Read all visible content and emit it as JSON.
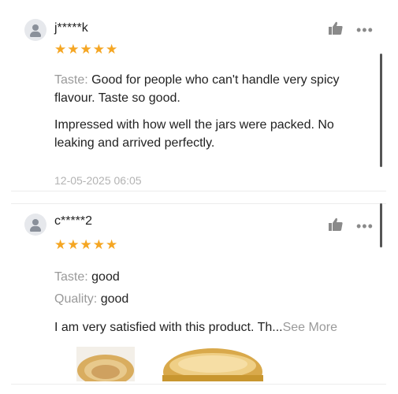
{
  "reviews": [
    {
      "username": "j*****k",
      "stars": "★★★★★",
      "taste_label": "Taste:",
      "taste_value": "Good for people who can't handle very spicy flavour.  Taste so good.",
      "comment": "Impressed with how well the jars were packed. No leaking and arrived perfectly.",
      "date": "12-05-2025 06:05"
    },
    {
      "username": "c*****2",
      "stars": "★★★★★",
      "taste_label": "Taste:",
      "taste_value": "good",
      "quality_label": "Quality:",
      "quality_value": "good",
      "comment": "I am very satisfied with this product.  Th...",
      "see_more": "See More"
    }
  ],
  "icons": {
    "like": "thumbs-up-icon",
    "more": "more-dots-icon",
    "avatar": "user-avatar-icon"
  },
  "colors": {
    "star": "#f5a623",
    "muted": "#9a9a9a",
    "date": "#b3b3b3"
  }
}
